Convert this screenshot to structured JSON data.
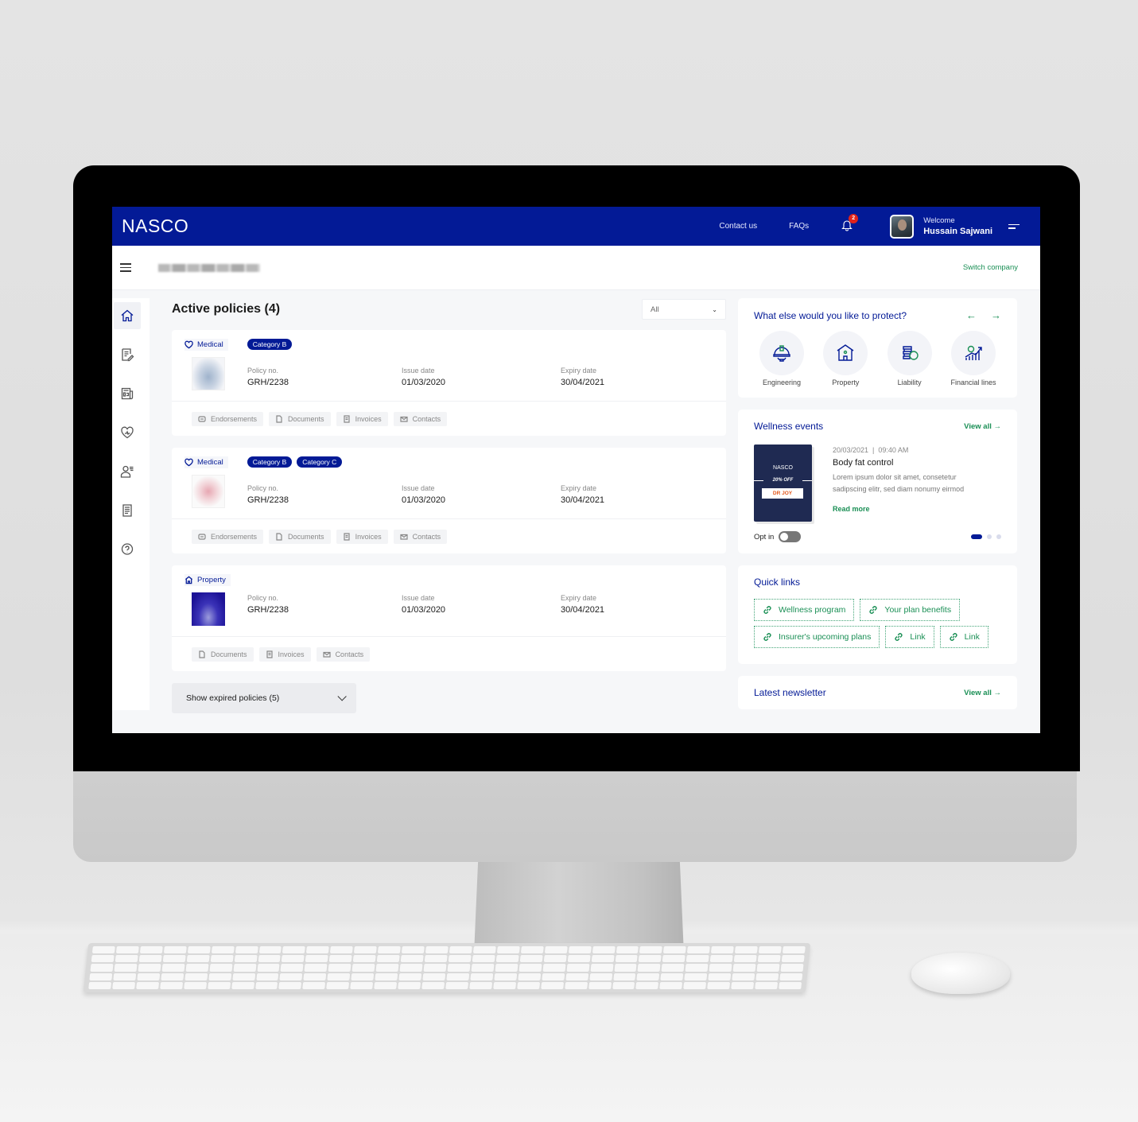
{
  "header": {
    "logo": "NASCO",
    "nav": [
      "Contact us",
      "FAQs"
    ],
    "notification_count": "2",
    "welcome_label": "Welcome",
    "user_name": "Hussain Sajwani"
  },
  "subbar": {
    "switch_company": "Switch company"
  },
  "sidenav": {
    "items": [
      "home",
      "claims",
      "news",
      "wellness",
      "members",
      "documents",
      "help"
    ]
  },
  "main": {
    "title": "Active policies (4)",
    "filter_value": "All",
    "field_labels": {
      "policy_no": "Policy no.",
      "issue_date": "Issue date",
      "expiry_date": "Expiry date"
    },
    "policies": [
      {
        "type": "Medical",
        "categories": [
          "Category B"
        ],
        "policy_no": "GRH/2238",
        "issue_date": "01/03/2020",
        "expiry_date": "30/04/2021",
        "actions": [
          "Endorsements",
          "Documents",
          "Invoices",
          "Contacts"
        ]
      },
      {
        "type": "Medical",
        "categories": [
          "Category B",
          "Category C"
        ],
        "policy_no": "GRH/2238",
        "issue_date": "01/03/2020",
        "expiry_date": "30/04/2021",
        "actions": [
          "Endorsements",
          "Documents",
          "Invoices",
          "Contacts"
        ]
      },
      {
        "type": "Property",
        "categories": [],
        "policy_no": "GRH/2238",
        "issue_date": "01/03/2020",
        "expiry_date": "30/04/2021",
        "actions": [
          "Documents",
          "Invoices",
          "Contacts"
        ]
      }
    ],
    "show_expired": "Show expired policies (5)"
  },
  "protect": {
    "title": "What else would you like to protect?",
    "items": [
      "Engineering",
      "Property",
      "Liability",
      "Financial lines"
    ]
  },
  "wellness": {
    "title": "Wellness events",
    "view_all": "View all",
    "event": {
      "date": "20/03/2021  |  09:40 AM",
      "title": "Body fat control",
      "description": "Lorem ipsum dolor sit amet, consetetur sadipscing elitr, sed diam nonumy eirmod",
      "read_more": "Read more",
      "poster_brand": "NASCO",
      "poster_offer": "20% OFF",
      "poster_partner": "DR JOY"
    },
    "opt_in_label": "Opt in",
    "opt_in_enabled": false,
    "slide_index": 1,
    "slide_count": 3
  },
  "quick_links": {
    "title": "Quick links",
    "items": [
      "Wellness program",
      "Your plan benefits",
      "Insurer's upcoming plans",
      "Link",
      "Link"
    ]
  },
  "newsletter": {
    "title": "Latest newsletter",
    "view_all": "View all"
  },
  "colors": {
    "brand_blue": "#031a96",
    "accent_green": "#1a8f55",
    "badge_red": "#e2231a"
  }
}
